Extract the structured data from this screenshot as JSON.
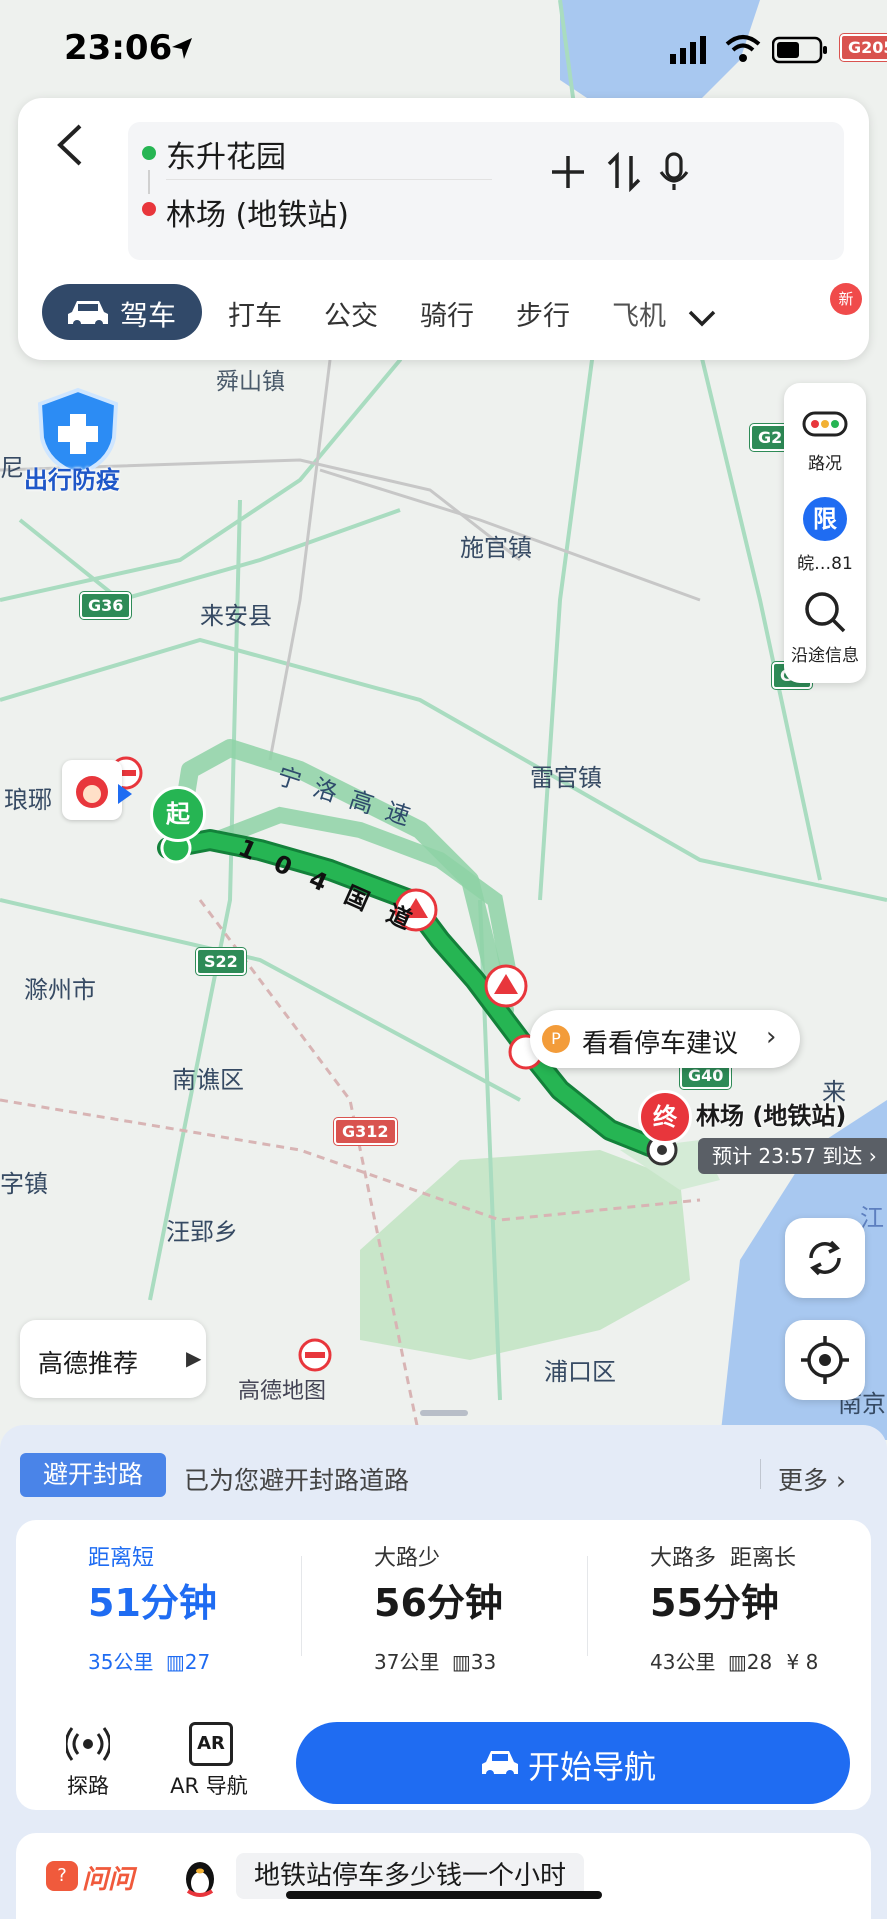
{
  "status_bar": {
    "time": "23:06"
  },
  "route": {
    "origin": "东升花园",
    "destination": "林场 (地铁站)"
  },
  "modes": [
    {
      "label": "驾车",
      "active": true
    },
    {
      "label": "打车"
    },
    {
      "label": "公交"
    },
    {
      "label": "骑行"
    },
    {
      "label": "步行"
    },
    {
      "label": "飞机"
    }
  ],
  "new_badge": "新",
  "right_panel": {
    "traffic": "路况",
    "restriction_icon": "限",
    "restriction": "皖…81",
    "along_route": "沿途信息"
  },
  "map": {
    "labels": {
      "shunshan": "舜山镇",
      "shiguan": "施官镇",
      "laian": "来安县",
      "langya": "琅琊",
      "leiguan": "雷官镇",
      "chuzhou": "滁州市",
      "nanqiao": "南谯区",
      "wangying": "汪郢乡",
      "pukou": "浦口区",
      "zizhen": "字镇",
      "ni": "尼",
      "nanjing": "南京",
      "jiang": "江",
      "lai": "来"
    },
    "shields": {
      "g36": "G36",
      "s22": "S22",
      "g312": "G312",
      "g40": "G40",
      "g205": "G205",
      "g2": "G2",
      "g20": "G2"
    },
    "road_ningluo": "宁洛高速",
    "road_104": "104国道",
    "start_marker": "起",
    "end_marker": "终",
    "end_label": "林场 (地铁站)",
    "eta": "预计 23:57 到达",
    "parking_tip": "看看停车建议",
    "epidemic": "出行防疫",
    "recommend": "高德推荐",
    "watermark": "高德地图"
  },
  "avoid": {
    "tag": "避开封路",
    "text": "已为您避开封路道路",
    "more": "更多"
  },
  "routes": [
    {
      "tag": "距离短",
      "time": "51分钟",
      "distance": "35公里",
      "lights": "27",
      "toll": "",
      "selected": true
    },
    {
      "tag": "大路少",
      "time": "56分钟",
      "distance": "37公里",
      "lights": "33",
      "toll": ""
    },
    {
      "tag": "大路多  距离长",
      "time": "55分钟",
      "distance": "43公里",
      "lights": "28",
      "toll": "¥ 8"
    }
  ],
  "actions": {
    "explore": "探路",
    "ar_icon": "AR",
    "ar": "AR 导航",
    "start": "开始导航"
  },
  "ask": {
    "brand": "问问",
    "question": "地铁站停车多少钱一个小时"
  },
  "colors": {
    "route_green": "#26b553",
    "primary_blue": "#1f6cf2",
    "drive_tab": "#314969",
    "avoid_tag": "#4a84e8",
    "destination_red": "#e8363c"
  }
}
